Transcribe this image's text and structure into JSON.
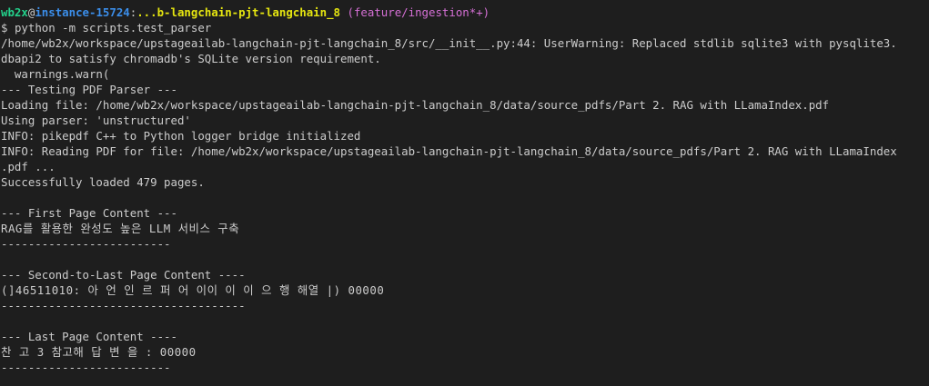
{
  "prompt": {
    "user": "wb2x",
    "at": "@",
    "host": "instance-15724",
    "colon": ":",
    "path": "...b-langchain-pjt-langchain_8",
    "branch": "(feature/ingestion*+)",
    "symbol": "$",
    "command": "python -m scripts.test_parser"
  },
  "output_lines": [
    "/home/wb2x/workspace/upstageailab-langchain-pjt-langchain_8/src/__init__.py:44: UserWarning: Replaced stdlib sqlite3 with pysqlite3.",
    "dbapi2 to satisfy chromadb's SQLite version requirement.",
    "  warnings.warn(",
    "--- Testing PDF Parser ---",
    "Loading file: /home/wb2x/workspace/upstageailab-langchain-pjt-langchain_8/data/source_pdfs/Part 2. RAG with LLamaIndex.pdf",
    "Using parser: 'unstructured'",
    "INFO: pikepdf C++ to Python logger bridge initialized",
    "INFO: Reading PDF for file: /home/wb2x/workspace/upstageailab-langchain-pjt-langchain_8/data/source_pdfs/Part 2. RAG with LLamaIndex",
    ".pdf ...",
    "Successfully loaded 479 pages.",
    "",
    "--- First Page Content ---",
    "RAG를 활용한 완성도 높은 LLM 서비스 구축",
    "-------------------------",
    "",
    "--- Second-to-Last Page Content ----",
    "(]46511010: 아 언 인 르 퍼 어 이이 이 이 으 행 해열 |) 00000",
    "------------------------------------",
    "",
    "--- Last Page Content ----",
    "찬 고 3 참고해 답 변 을 : 00000",
    "-------------------------"
  ]
}
